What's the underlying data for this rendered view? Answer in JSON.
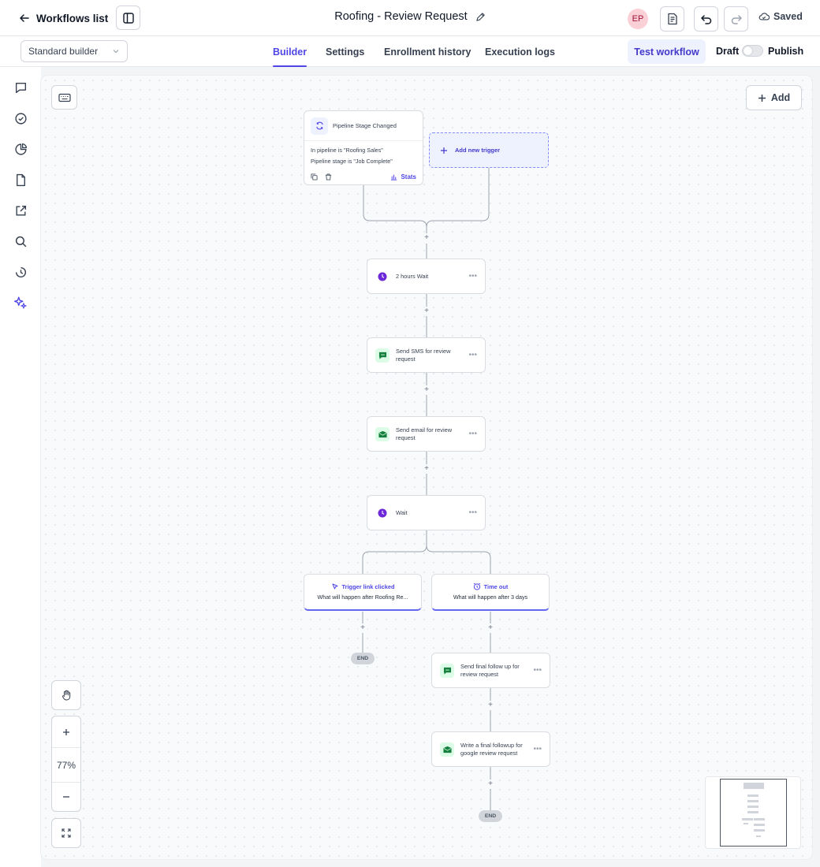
{
  "header": {
    "back_label": "Workflows list",
    "title": "Roofing - Review Request",
    "avatar_initials": "EP",
    "saved_label": "Saved"
  },
  "subbar": {
    "builder_select": "Standard builder",
    "tabs": [
      {
        "label": "Builder",
        "active": true
      },
      {
        "label": "Settings",
        "active": false
      },
      {
        "label": "Enrollment history",
        "active": false
      },
      {
        "label": "Execution logs",
        "active": false
      }
    ],
    "test_workflow": "Test workflow",
    "draft_label": "Draft",
    "publish_label": "Publish",
    "published": false
  },
  "left_nav": [
    "chat-icon",
    "check-circle-icon",
    "pie-chart-icon",
    "file-icon",
    "external-link-icon",
    "search-icon",
    "history-icon",
    "sparkle-icon"
  ],
  "canvas": {
    "add_label": "Add",
    "trigger": {
      "title": "Pipeline Stage Changed",
      "condition_1": "In pipeline is \"Roofing Sales\"",
      "condition_2": "Pipeline stage is \"Job Complete\"",
      "stats_label": "Stats"
    },
    "add_trigger_label": "Add new trigger",
    "steps": [
      {
        "label": "2 hours Wait",
        "icon": "clock-icon"
      },
      {
        "label": "Send SMS for review request",
        "icon": "sms-icon"
      },
      {
        "label": "Send email for review request",
        "icon": "email-icon"
      },
      {
        "label": "Wait",
        "icon": "clock-icon"
      }
    ],
    "branches": [
      {
        "title": "Trigger link clicked",
        "desc": "What will happen after Roofing Re..."
      },
      {
        "title": "Time out",
        "desc": "What will happen after 3 days"
      }
    ],
    "branch2_steps": [
      {
        "label": "Send final follow up for review request",
        "icon": "sms-icon"
      },
      {
        "label": "Write a final followup for google review request",
        "icon": "email-icon"
      }
    ],
    "end_label": "END",
    "zoom": "77%"
  },
  "colors": {
    "accent": "#4f46e5",
    "clock": "#6d28d9",
    "message": "#15803d",
    "avatar_bg": "#fbcfd6"
  }
}
